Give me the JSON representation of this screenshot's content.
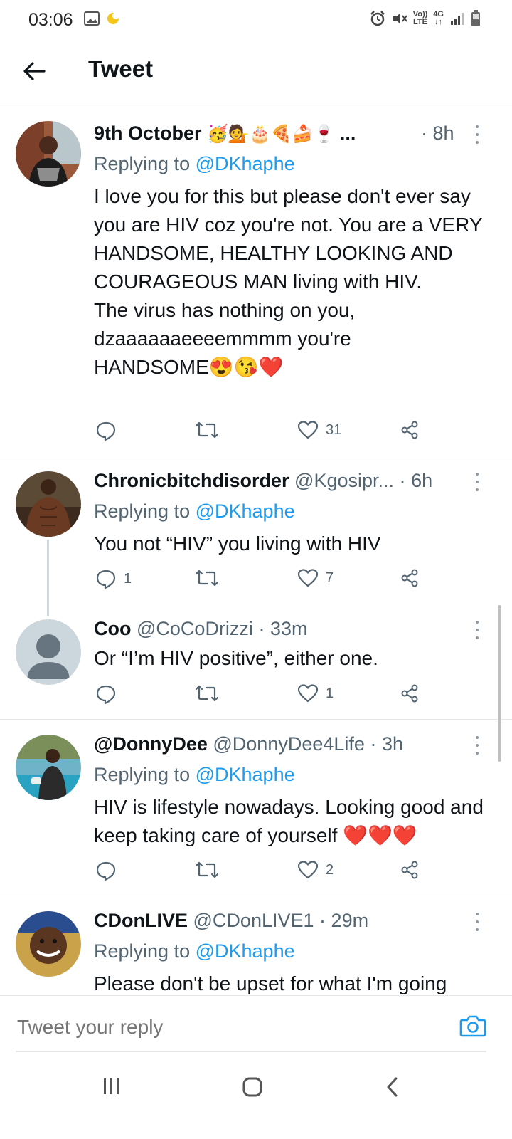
{
  "status_bar": {
    "time": "03:06",
    "lte_top": "Vo))",
    "lte_bottom": "LTE",
    "net_top": "4G",
    "net_bottom": "↓↑"
  },
  "header": {
    "title": "Tweet"
  },
  "tweets": [
    {
      "name": "9th October",
      "name_emoji": "🥳💁🎂🍕🍰🍷",
      "ellipsis": "...",
      "handle": "",
      "dot": "·",
      "time": "8h",
      "replying_prefix": "Replying to",
      "replying_to": "@DKhaphe",
      "body": [
        "I love you for this but please don't ever say you are HIV coz you're not. You are a VERY HANDSOME, HEALTHY LOOKING AND COURAGEOUS MAN living with HIV.",
        "The virus has nothing on you, dzaaaaaaeeeemmmm you're",
        "HANDSOME"
      ],
      "body_emoji": "😍😘❤️",
      "replies": "",
      "retweets": "",
      "likes": "31"
    },
    {
      "name": "Chronicbitchdisorder",
      "handle": "@Kgosipr...",
      "dot": "·",
      "time": "6h",
      "replying_prefix": "Replying to",
      "replying_to": "@DKhaphe",
      "body": [
        "You not “HIV” you living with HIV"
      ],
      "replies": "1",
      "retweets": "",
      "likes": "7"
    },
    {
      "name": "Coo",
      "handle": "@CoCoDrizzi",
      "dot": "·",
      "time": "33m",
      "body": [
        "Or “I’m HIV positive”, either one."
      ],
      "replies": "",
      "retweets": "",
      "likes": "1"
    },
    {
      "name": "@DonnyDee",
      "handle": "@DonnyDee4Life",
      "dot": "·",
      "time": "3h",
      "replying_prefix": "Replying to",
      "replying_to": "@DKhaphe",
      "body": [
        "HIV is lifestyle nowadays. Looking good and keep taking care of yourself"
      ],
      "body_emoji": "❤️❤️❤️",
      "replies": "",
      "retweets": "",
      "likes": "2"
    },
    {
      "name": "CDonLIVE",
      "handle": "@CDonLIVE1",
      "dot": "·",
      "time": "29m",
      "replying_prefix": "Replying to",
      "replying_to": "@DKhaphe",
      "body": [
        "Please don't be upset for what I'm going"
      ]
    }
  ],
  "reply_bar": {
    "placeholder": "Tweet your reply"
  },
  "colors": {
    "link": "#1d9bf0",
    "secondary": "#536471",
    "divider": "#e6e6e6"
  },
  "icons": [
    "back-arrow-icon",
    "reply-icon",
    "retweet-icon",
    "like-icon",
    "share-icon",
    "camera-icon",
    "more-icon"
  ]
}
